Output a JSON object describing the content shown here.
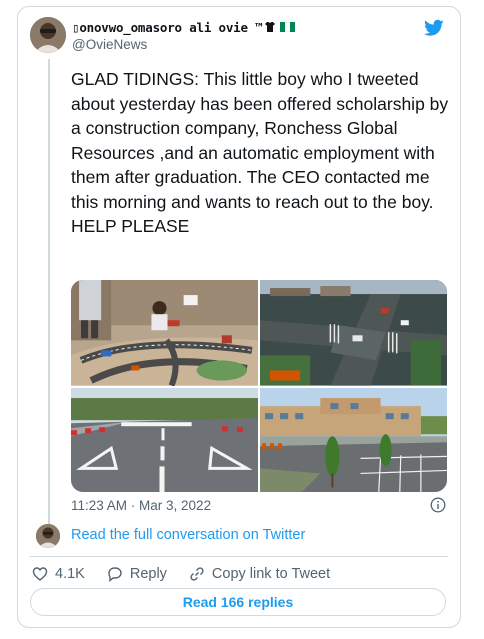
{
  "author": {
    "display_name": "▯onovwo_omasoro ali ovie ™",
    "handle": "@OvieNews",
    "avatar_icon": "avatar-portrait",
    "flag_colors": [
      "#008751",
      "#ffffff",
      "#008751"
    ]
  },
  "tweet": {
    "text": "GLAD TIDINGS: This little boy who I tweeted about yesterday has been offered scholarship by a construction company, Ronchess Global Resources ,and an automatic employment with them after graduation. The CEO contacted me this morning and wants to reach out to the boy.  HELP PLEASE",
    "timestamp": "11:23 AM · Mar 3, 2022"
  },
  "conversation_link": "Read the full conversation on Twitter",
  "actions": {
    "likes": "4.1K",
    "reply_label": "Reply",
    "copy_label": "Copy link to Tweet"
  },
  "read_replies_label": "Read 166 replies",
  "colors": {
    "accent": "#1d9bf0",
    "muted": "#536471",
    "border": "#cfd9de"
  }
}
